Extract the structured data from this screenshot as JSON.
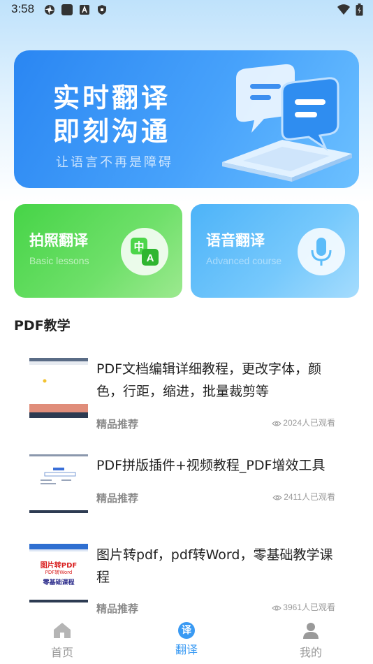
{
  "status_bar": {
    "time": "3:58"
  },
  "banner": {
    "title_line1": "实时翻译",
    "title_line2": "即刻沟通",
    "subtitle": "让语言不再是障碍"
  },
  "features": [
    {
      "title": "拍照翻译",
      "subtitle": "Basic lessons",
      "icon": "translate-icon",
      "color": "#4cd64a"
    },
    {
      "title": "语音翻译",
      "subtitle": "Advanced course",
      "icon": "microphone-icon",
      "color": "#5bbcf9"
    }
  ],
  "section": {
    "title": "PDF教学"
  },
  "items": [
    {
      "title": "PDF文档编辑详细教程，更改字体，颜色，行距，缩进，批量裁剪等",
      "tag": "精品推荐",
      "views": "2024人已观看"
    },
    {
      "title": "PDF拼版插件+视频教程_PDF增效工具",
      "tag": "精品推荐",
      "views": "2411人已观看"
    },
    {
      "title": "图片转pdf，pdf转Word，零基础教学课程",
      "tag": "精品推荐",
      "views": "3961人已观看",
      "thumb_text": {
        "line1": "图片转PDF",
        "line2": "PDF转Word",
        "line3": "零基础课程"
      }
    }
  ],
  "tabbar": {
    "tabs": [
      {
        "label": "首页",
        "icon": "home-icon",
        "active": false
      },
      {
        "label": "翻译",
        "icon": "translate-badge-icon",
        "active": true,
        "badge_char": "译"
      },
      {
        "label": "我的",
        "icon": "profile-icon",
        "active": false
      }
    ],
    "active_color": "#3a9af3",
    "inactive_color": "#9a9a9a"
  }
}
